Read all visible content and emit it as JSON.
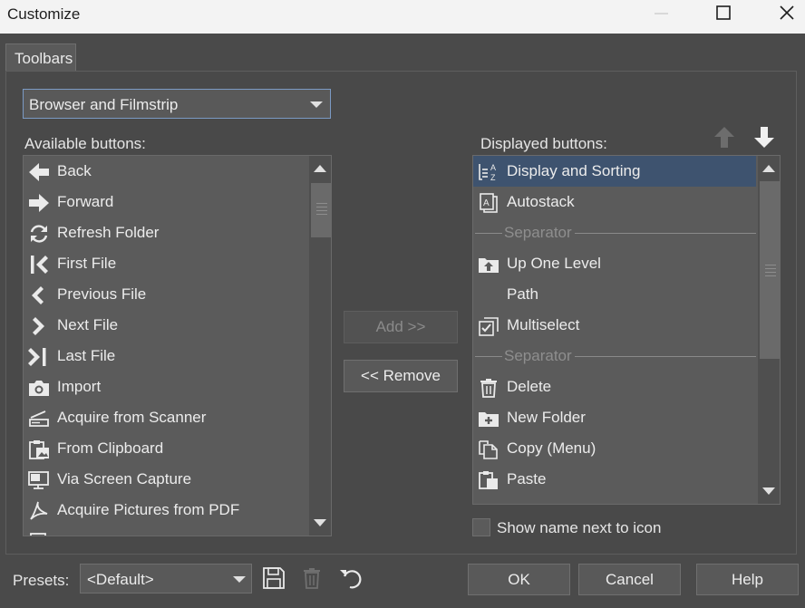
{
  "window": {
    "title": "Customize"
  },
  "tabs": [
    {
      "label": "Toolbars"
    }
  ],
  "toolbar_select": {
    "value": "Browser and Filmstrip"
  },
  "available": {
    "label": "Available buttons:",
    "items": [
      {
        "label": "Back",
        "icon": "back-arrow-icon"
      },
      {
        "label": "Forward",
        "icon": "forward-arrow-icon"
      },
      {
        "label": "Refresh Folder",
        "icon": "refresh-icon"
      },
      {
        "label": "First File",
        "icon": "first-file-icon"
      },
      {
        "label": "Previous File",
        "icon": "previous-file-icon"
      },
      {
        "label": "Next File",
        "icon": "next-file-icon"
      },
      {
        "label": "Last File",
        "icon": "last-file-icon"
      },
      {
        "label": "Import",
        "icon": "camera-icon"
      },
      {
        "label": "Acquire from Scanner",
        "icon": "scanner-icon"
      },
      {
        "label": "From Clipboard",
        "icon": "clipboard-image-icon"
      },
      {
        "label": "Via Screen Capture",
        "icon": "monitor-icon"
      },
      {
        "label": "Acquire Pictures from PDF",
        "icon": "pdf-icon"
      }
    ]
  },
  "displayed": {
    "label": "Displayed buttons:",
    "items": [
      {
        "label": "Display and Sorting",
        "icon": "sort-az-icon",
        "selected": true
      },
      {
        "label": "Autostack",
        "icon": "autostack-icon"
      },
      {
        "label": "Separator",
        "separator": true
      },
      {
        "label": "Up One Level",
        "icon": "folder-up-icon"
      },
      {
        "label": "Path",
        "icon": ""
      },
      {
        "label": "Multiselect",
        "icon": "multiselect-icon"
      },
      {
        "label": "Separator",
        "separator": true
      },
      {
        "label": "Delete",
        "icon": "trash-icon"
      },
      {
        "label": "New Folder",
        "icon": "new-folder-icon"
      },
      {
        "label": "Copy (Menu)",
        "icon": "copy-icon"
      },
      {
        "label": "Paste",
        "icon": "paste-icon"
      }
    ]
  },
  "actions": {
    "add": "Add >>",
    "remove": "<< Remove"
  },
  "show_name": {
    "label": "Show name next to icon",
    "checked": false
  },
  "presets": {
    "label": "Presets:",
    "value": "<Default>"
  },
  "buttons": {
    "ok": "OK",
    "cancel": "Cancel",
    "help": "Help"
  }
}
